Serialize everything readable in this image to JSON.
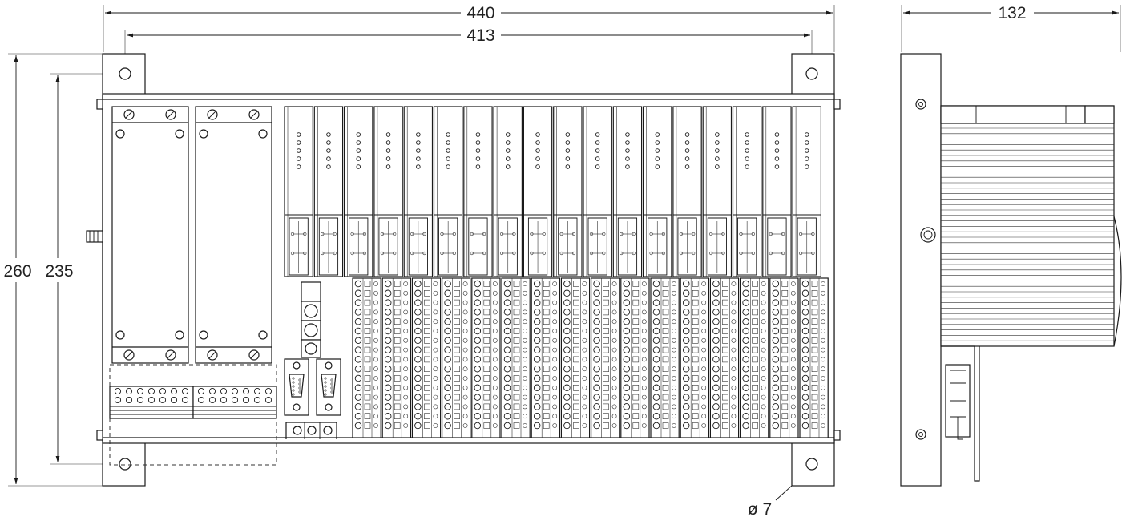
{
  "drawing": {
    "dimensions": {
      "overall_width": "440",
      "hole_spacing_width": "413",
      "depth": "132",
      "overall_height": "260",
      "hole_spacing_height": "235",
      "hole_diameter": "ø 7"
    },
    "front_view": {
      "io_module_count": 18,
      "terminal_block_count": 16,
      "connector_plates": 2,
      "sub_d_connectors": 2
    },
    "side_view": {
      "heatsink_fins": 40
    }
  }
}
